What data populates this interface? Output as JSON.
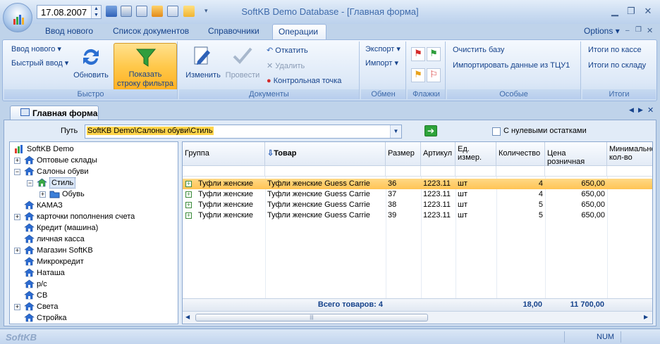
{
  "titlebar": {
    "date": "17.08.2007",
    "title": "SoftKB Demo Database - [Главная форма]",
    "options": "Options"
  },
  "ribbon_tabs": [
    "Ввод нового",
    "Список документов",
    "Справочники",
    "Операции"
  ],
  "ribbon": {
    "quick": {
      "vvod_novogo": "Ввод нового",
      "bystry_vvod": "Быстрый ввод",
      "obnovit": "Обновить",
      "filter_line1": "Показать",
      "filter_line2": "строку фильтра",
      "label": "Быстро"
    },
    "docs": {
      "izmenit": "Изменить",
      "provesti": "Провести",
      "otkatit": "Откатить",
      "udalit": "Удалить",
      "kontrol": "Контрольная точка",
      "label": "Документы"
    },
    "exchange": {
      "export": "Экспорт",
      "import": "Импорт",
      "label": "Обмен"
    },
    "flags": {
      "label": "Флажки"
    },
    "special": {
      "clear": "Очистить базу",
      "import_tcu": "Импортировать данные из ТЦУ1",
      "label": "Особые"
    },
    "totals": {
      "shop": "Итоги по кассе",
      "stock": "Итоги по складу",
      "label": "Итоги"
    }
  },
  "doc_tab": "Главная форма",
  "path": {
    "label": "Путь",
    "value": "SoftKB Demo\\Салоны обуви\\Стиль",
    "zero_label": "С нулевыми остатками"
  },
  "tree": [
    {
      "label": "SoftKB Demo",
      "level": 0,
      "toggle": "",
      "icon": "chart"
    },
    {
      "label": "Оптовые склады",
      "level": 0,
      "toggle": "+",
      "icon": "house"
    },
    {
      "label": "Салоны обуви",
      "level": 0,
      "toggle": "-",
      "icon": "house"
    },
    {
      "label": "Стиль",
      "level": 1,
      "toggle": "-",
      "icon": "house-green",
      "selected": true
    },
    {
      "label": "Обувь",
      "level": 2,
      "toggle": "+",
      "icon": "folder"
    },
    {
      "label": "КАМАЗ",
      "level": 0,
      "toggle": "",
      "icon": "house"
    },
    {
      "label": "карточки пополнения счета",
      "level": 0,
      "toggle": "+",
      "icon": "house"
    },
    {
      "label": "Кредит (машина)",
      "level": 0,
      "toggle": "",
      "icon": "house"
    },
    {
      "label": "личная касса",
      "level": 0,
      "toggle": "",
      "icon": "house"
    },
    {
      "label": "Магазин SoftKB",
      "level": 0,
      "toggle": "+",
      "icon": "house"
    },
    {
      "label": "Микрокредит",
      "level": 0,
      "toggle": "",
      "icon": "house"
    },
    {
      "label": "Наташа",
      "level": 0,
      "toggle": "",
      "icon": "house"
    },
    {
      "label": "р/с",
      "level": 0,
      "toggle": "",
      "icon": "house"
    },
    {
      "label": "СВ",
      "level": 0,
      "toggle": "",
      "icon": "house"
    },
    {
      "label": "Света",
      "level": 0,
      "toggle": "+",
      "icon": "house"
    },
    {
      "label": "Стройка",
      "level": 0,
      "toggle": "",
      "icon": "house"
    }
  ],
  "grid": {
    "columns": [
      "Группа",
      "Товар",
      "Размер",
      "Артикул",
      "Ед. измер.",
      "Количество",
      "Цена розничная",
      "Минимально кол-во"
    ],
    "rows": [
      [
        "Туфли женские",
        "Туфли женские Guess Carrie",
        "36",
        "1223.11",
        "шт",
        "4",
        "650,00",
        ""
      ],
      [
        "Туфли женские",
        "Туфли женские Guess Carrie",
        "37",
        "1223.11",
        "шт",
        "4",
        "650,00",
        ""
      ],
      [
        "Туфли женские",
        "Туфли женские Guess Carrie",
        "38",
        "1223.11",
        "шт",
        "5",
        "650,00",
        ""
      ],
      [
        "Туфли женские",
        "Туфли женские Guess Carrie",
        "39",
        "1223.11",
        "шт",
        "5",
        "650,00",
        ""
      ]
    ],
    "footer": {
      "total_label": "Всего товаров: 4",
      "qty": "18,00",
      "sum": "11 700,00"
    }
  },
  "status": {
    "logo": "SoftKB",
    "num": "NUM"
  }
}
